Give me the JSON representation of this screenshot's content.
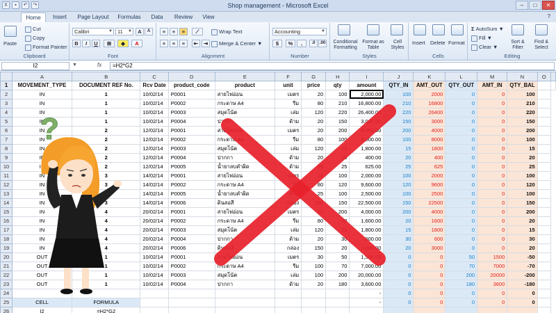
{
  "window": {
    "title": "Shop management - Microsoft Excel"
  },
  "tabs": [
    "Home",
    "Insert",
    "Page Layout",
    "Formulas",
    "Data",
    "Review",
    "View"
  ],
  "ribbon": {
    "clipboard": {
      "paste": "Paste",
      "cut": "Cut",
      "copy": "Copy",
      "format_painter": "Format Painter",
      "label": "Clipboard"
    },
    "font": {
      "name": "Calibri",
      "size": "11",
      "label": "Font",
      "bold": "B",
      "italic": "I",
      "underline": "U"
    },
    "alignment": {
      "wrap": "Wrap Text",
      "merge": "Merge & Center",
      "label": "Alignment"
    },
    "number": {
      "format": "Accounting",
      "currency": "$",
      "percent": "%",
      "comma": ",",
      "label": "Number"
    },
    "styles": {
      "conditional": "Conditional Formatting",
      "format_table": "Format as Table",
      "cell_styles": "Cell Styles",
      "label": "Styles"
    },
    "cells": {
      "insert": "Insert",
      "delete": "Delete",
      "format": "Format",
      "label": "Cells"
    },
    "editing": {
      "autosum": "AutoSum",
      "fill": "Fill",
      "clear": "Clear",
      "sort": "Sort & Filter",
      "find": "Find & Select",
      "label": "Editing"
    }
  },
  "formula_bar": {
    "name_box": "I2",
    "fx": "fx",
    "formula": "=H2*G2"
  },
  "columns": [
    "A",
    "B",
    "C",
    "D",
    "E",
    "F",
    "G",
    "H",
    "I",
    "J",
    "K",
    "L",
    "M",
    "N",
    "O"
  ],
  "header_row": [
    "MOVEMENT_TYPE",
    "DOCUMENT REF No.",
    "Rcv Date",
    "product_code",
    "product",
    "unit",
    "price",
    "qty",
    "amount",
    "QTY_IN",
    "AMT_OUT",
    "QTY_OUT",
    "AMT_IN",
    "QTY_BAL",
    ""
  ],
  "rows": [
    [
      "IN",
      "1",
      "10/02/14",
      "P0001",
      "สายไฟอ่อน",
      "เมตร",
      "20",
      "100",
      "2,000.00",
      "100",
      "2000",
      "0",
      "0",
      "100"
    ],
    [
      "IN",
      "1",
      "10/02/14",
      "P0002",
      "กระดาษ A4",
      "รีม",
      "80",
      "210",
      "16,800.00",
      "210",
      "16800",
      "0",
      "0",
      "210"
    ],
    [
      "IN",
      "1",
      "10/02/14",
      "P0003",
      "สมุดโน้ต",
      "เล่ม",
      "120",
      "220",
      "26,400.00",
      "220",
      "26400",
      "0",
      "0",
      "220"
    ],
    [
      "IN",
      "1",
      "10/02/14",
      "P0004",
      "ปากกา",
      "ด้าม",
      "20",
      "150",
      "3,000.00",
      "150",
      "3000",
      "0",
      "0",
      "150"
    ],
    [
      "IN",
      "2",
      "12/02/14",
      "P0001",
      "สายไฟอ่อน",
      "เมตร",
      "20",
      "200",
      "4,000.00",
      "200",
      "4000",
      "0",
      "0",
      "200"
    ],
    [
      "IN",
      "2",
      "12/02/14",
      "P0002",
      "กระดาษ A4",
      "รีม",
      "80",
      "100",
      "8,000.00",
      "100",
      "8000",
      "0",
      "0",
      "100"
    ],
    [
      "IN",
      "2",
      "12/02/14",
      "P0003",
      "สมุดโน้ต",
      "เล่ม",
      "120",
      "15",
      "1,800.00",
      "15",
      "1800",
      "0",
      "0",
      "15"
    ],
    [
      "IN",
      "2",
      "12/02/14",
      "P0004",
      "ปากกา",
      "ด้าม",
      "20",
      "20",
      "400.00",
      "20",
      "400",
      "0",
      "0",
      "20"
    ],
    [
      "IN",
      "2",
      "12/02/14",
      "P0005",
      "น้ำยาลบคำผิด",
      "ด้าม",
      "25",
      "25",
      "625.00",
      "25",
      "625",
      "0",
      "0",
      "25"
    ],
    [
      "IN",
      "3",
      "14/02/14",
      "P0001",
      "สายไฟอ่อน",
      "เมตร",
      "20",
      "100",
      "2,000.00",
      "100",
      "2000",
      "0",
      "0",
      "100"
    ],
    [
      "IN",
      "3",
      "14/02/14",
      "P0002",
      "กระดาษ A4",
      "รีม",
      "80",
      "120",
      "9,600.00",
      "120",
      "9600",
      "0",
      "0",
      "120"
    ],
    [
      "IN",
      "3",
      "14/02/14",
      "P0005",
      "น้ำยาลบคำผิด",
      "ด้าม",
      "25",
      "100",
      "2,500.00",
      "100",
      "2500",
      "0",
      "0",
      "100"
    ],
    [
      "IN",
      "3",
      "14/02/14",
      "P0006",
      "ดินสอสี",
      "กล่อง",
      "150",
      "150",
      "22,500.00",
      "150",
      "22500",
      "0",
      "0",
      "150"
    ],
    [
      "IN",
      "4",
      "20/02/14",
      "P0001",
      "สายไฟอ่อน",
      "เมตร",
      "20",
      "200",
      "4,000.00",
      "200",
      "4000",
      "0",
      "0",
      "200"
    ],
    [
      "IN",
      "4",
      "20/02/14",
      "P0002",
      "กระดาษ A4",
      "รีม",
      "80",
      "20",
      "1,600.00",
      "20",
      "1600",
      "0",
      "0",
      "20"
    ],
    [
      "IN",
      "4",
      "20/02/14",
      "P0003",
      "สมุดโน้ต",
      "เล่ม",
      "120",
      "15",
      "1,800.00",
      "15",
      "1800",
      "0",
      "0",
      "15"
    ],
    [
      "IN",
      "4",
      "20/02/14",
      "P0004",
      "ปากกา",
      "ด้าม",
      "20",
      "30",
      "600.00",
      "30",
      "600",
      "0",
      "0",
      "30"
    ],
    [
      "IN",
      "4",
      "20/02/14",
      "P0006",
      "ดินสอสี",
      "กล่อง",
      "150",
      "20",
      "3,000.00",
      "20",
      "3000",
      "0",
      "0",
      "20"
    ],
    [
      "OUT",
      "1",
      "10/02/14",
      "P0001",
      "สายไฟอ่อน",
      "เมตร",
      "30",
      "50",
      "1,500.00",
      "0",
      "0",
      "50",
      "1500",
      "-50"
    ],
    [
      "OUT",
      "1",
      "10/02/14",
      "P0002",
      "กระดาษ A4",
      "รีม",
      "100",
      "70",
      "7,000.00",
      "0",
      "0",
      "70",
      "7000",
      "-70"
    ],
    [
      "OUT",
      "1",
      "10/02/14",
      "P0003",
      "สมุดโน้ต",
      "เล่ม",
      "100",
      "200",
      "20,000.00",
      "0",
      "0",
      "200",
      "20000",
      "-200"
    ],
    [
      "OUT",
      "1",
      "10/02/14",
      "P0004",
      "ปากกา",
      "ด้าม",
      "20",
      "180",
      "3,600.00",
      "0",
      "0",
      "180",
      "3600",
      "-180"
    ],
    [
      "",
      "",
      "",
      "",
      "",
      "",
      "",
      "",
      "-",
      "0",
      "0",
      "0",
      "0",
      "0"
    ],
    [
      "CELL",
      "FORMULA",
      "",
      "",
      "",
      "",
      "",
      "",
      "-",
      "0",
      "0",
      "0",
      "0",
      "0"
    ],
    [
      "I2",
      "=H2*G2",
      "",
      "",
      "",
      "",
      "",
      "",
      "",
      "",
      "",
      "",
      "",
      ""
    ]
  ],
  "annotation": {
    "question_mark": "?"
  },
  "colors": {
    "accent_blue": "#1a7fc4",
    "accent_red": "#e0201e",
    "cross": "#e8212b"
  }
}
